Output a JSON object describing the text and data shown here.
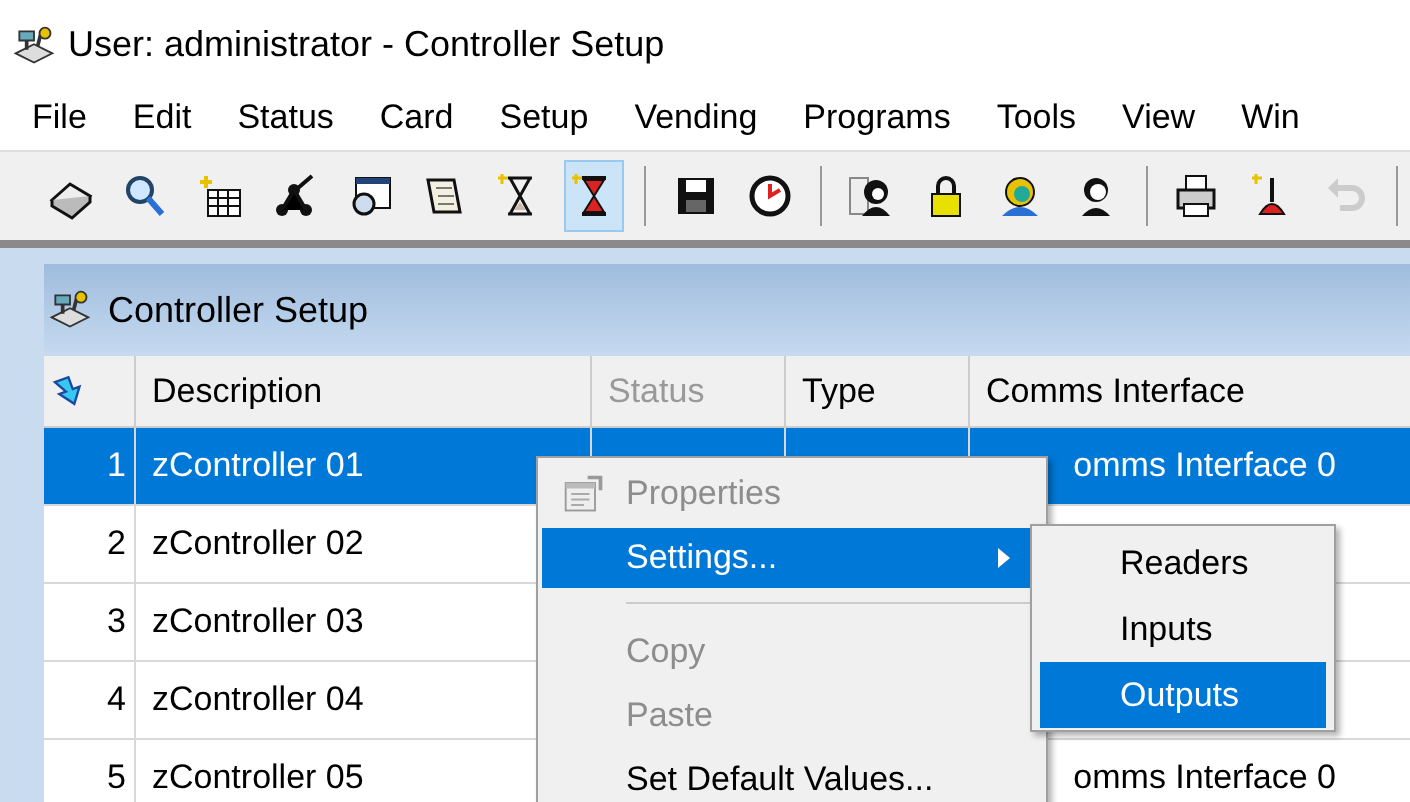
{
  "window": {
    "title": "User: administrator - Controller Setup"
  },
  "menu_bar": [
    "File",
    "Edit",
    "Status",
    "Card",
    "Setup",
    "Vending",
    "Programs",
    "Tools",
    "View",
    "Win"
  ],
  "toolbar": [
    {
      "kind": "button",
      "selected": false,
      "disabled": false
    },
    {
      "kind": "button",
      "selected": false,
      "disabled": false
    },
    {
      "kind": "button",
      "selected": false,
      "disabled": false
    },
    {
      "kind": "button",
      "selected": false,
      "disabled": false
    },
    {
      "kind": "button",
      "selected": false,
      "disabled": false
    },
    {
      "kind": "button",
      "selected": false,
      "disabled": false
    },
    {
      "kind": "button",
      "selected": false,
      "disabled": false
    },
    {
      "kind": "button",
      "selected": true,
      "disabled": false
    },
    {
      "kind": "separator"
    },
    {
      "kind": "button",
      "selected": false,
      "disabled": false
    },
    {
      "kind": "button",
      "selected": false,
      "disabled": false
    },
    {
      "kind": "separator"
    },
    {
      "kind": "button",
      "selected": false,
      "disabled": false
    },
    {
      "kind": "button",
      "selected": false,
      "disabled": false
    },
    {
      "kind": "button",
      "selected": false,
      "disabled": false
    },
    {
      "kind": "button",
      "selected": false,
      "disabled": false
    },
    {
      "kind": "separator"
    },
    {
      "kind": "button",
      "selected": false,
      "disabled": false
    },
    {
      "kind": "button",
      "selected": false,
      "disabled": false
    },
    {
      "kind": "button",
      "selected": false,
      "disabled": true
    },
    {
      "kind": "separator"
    }
  ],
  "child_window": {
    "title": "Controller Setup",
    "table": {
      "columns": [
        {
          "label": "Description",
          "disabled": false
        },
        {
          "label": "Status",
          "disabled": true
        },
        {
          "label": "Type",
          "disabled": false
        },
        {
          "label": "Comms Interface",
          "disabled": false
        }
      ],
      "rows": [
        {
          "number": "1",
          "description": "zController 01",
          "comms": "omms Interface 0",
          "selected": true
        },
        {
          "number": "2",
          "description": "zController 02",
          "selected": false
        },
        {
          "number": "3",
          "description": "zController 03",
          "selected": false
        },
        {
          "number": "4",
          "description": "zController 04",
          "selected": false
        },
        {
          "number": "5",
          "description": "zController 05",
          "comms": "omms Interface 0",
          "selected": false
        }
      ]
    }
  },
  "context_menu": {
    "items": [
      {
        "kind": "item",
        "label": "Properties",
        "disabled": true,
        "selected": false,
        "has_icon": true
      },
      {
        "kind": "item",
        "label": "Settings...",
        "disabled": false,
        "selected": true,
        "submenu": true
      },
      {
        "kind": "separator"
      },
      {
        "kind": "item",
        "label": "Copy",
        "disabled": true,
        "selected": false
      },
      {
        "kind": "item",
        "label": "Paste",
        "disabled": true,
        "selected": false
      },
      {
        "kind": "item",
        "label": "Set Default Values...",
        "disabled": false,
        "selected": false
      }
    ]
  },
  "submenu": {
    "items": [
      {
        "label": "Readers",
        "selected": false
      },
      {
        "label": "Inputs",
        "selected": false
      },
      {
        "label": "Outputs",
        "selected": true
      }
    ]
  }
}
